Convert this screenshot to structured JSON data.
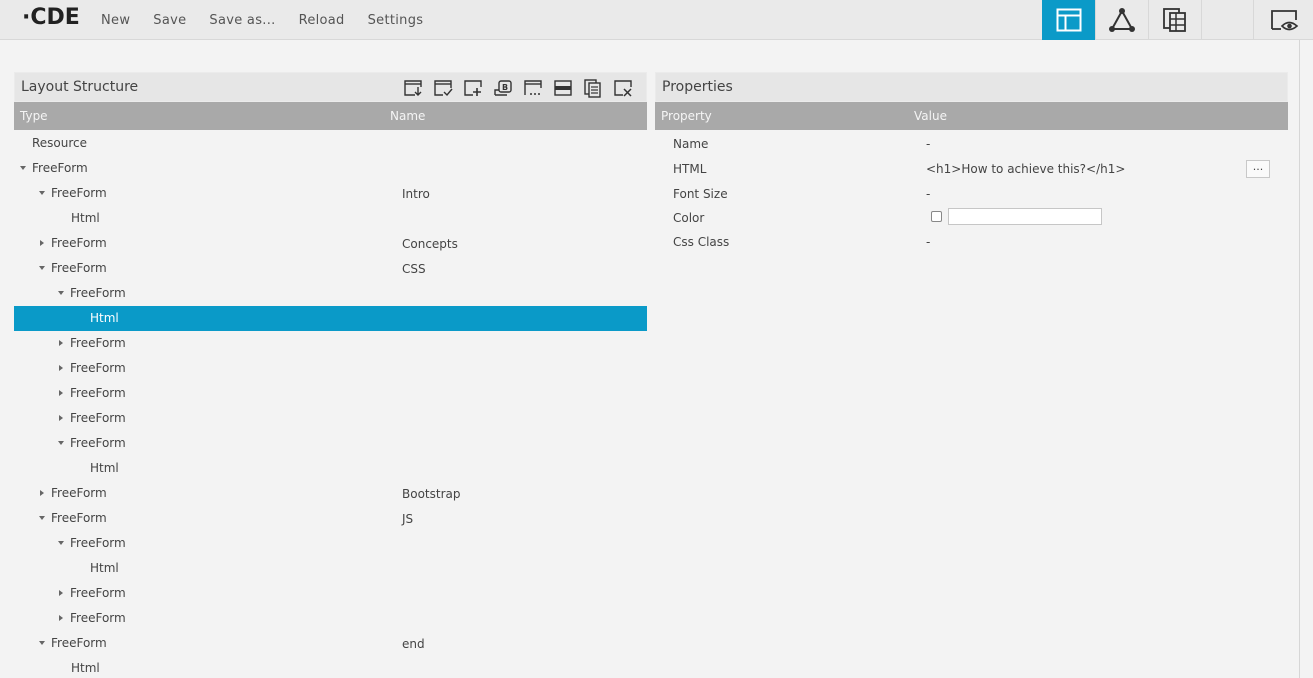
{
  "app": {
    "logo": "CDE",
    "logo_prefix": "·"
  },
  "menu": {
    "new": "New",
    "save": "Save",
    "save_as": "Save as...",
    "reload": "Reload",
    "settings": "Settings"
  },
  "view_buttons": [
    {
      "icon": "layout-icon",
      "active": true
    },
    {
      "icon": "components-icon",
      "active": false
    },
    {
      "icon": "datasources-icon",
      "active": false
    },
    {
      "icon": "preview-icon",
      "active": false
    }
  ],
  "layout": {
    "title": "Layout Structure",
    "col_type": "Type",
    "col_name": "Name",
    "toolbar": [
      "save-template-icon",
      "apply-template-icon",
      "add-row-icon",
      "add-bootstrap-panel-icon",
      "add-freeform-icon",
      "add-html-icon",
      "duplicate-icon",
      "delete-icon"
    ],
    "rows": [
      {
        "type": "Resource",
        "name": "",
        "depth": 0,
        "toggle": "none"
      },
      {
        "type": "FreeForm",
        "name": "",
        "depth": 0,
        "toggle": "down"
      },
      {
        "type": "FreeForm",
        "name": "Intro",
        "depth": 1,
        "toggle": "down"
      },
      {
        "type": "Html",
        "name": "",
        "depth": 2,
        "toggle": "none"
      },
      {
        "type": "FreeForm",
        "name": "Concepts",
        "depth": 1,
        "toggle": "right"
      },
      {
        "type": "FreeForm",
        "name": "CSS",
        "depth": 1,
        "toggle": "down"
      },
      {
        "type": "FreeForm",
        "name": "",
        "depth": 2,
        "toggle": "down"
      },
      {
        "type": "Html",
        "name": "",
        "depth": 3,
        "toggle": "none",
        "selected": true
      },
      {
        "type": "FreeForm",
        "name": "",
        "depth": 2,
        "toggle": "right"
      },
      {
        "type": "FreeForm",
        "name": "",
        "depth": 2,
        "toggle": "right"
      },
      {
        "type": "FreeForm",
        "name": "",
        "depth": 2,
        "toggle": "right"
      },
      {
        "type": "FreeForm",
        "name": "",
        "depth": 2,
        "toggle": "right"
      },
      {
        "type": "FreeForm",
        "name": "",
        "depth": 2,
        "toggle": "down"
      },
      {
        "type": "Html",
        "name": "",
        "depth": 3,
        "toggle": "none"
      },
      {
        "type": "FreeForm",
        "name": "Bootstrap",
        "depth": 1,
        "toggle": "right"
      },
      {
        "type": "FreeForm",
        "name": "JS",
        "depth": 1,
        "toggle": "down"
      },
      {
        "type": "FreeForm",
        "name": "",
        "depth": 2,
        "toggle": "down"
      },
      {
        "type": "Html",
        "name": "",
        "depth": 3,
        "toggle": "none"
      },
      {
        "type": "FreeForm",
        "name": "",
        "depth": 2,
        "toggle": "right"
      },
      {
        "type": "FreeForm",
        "name": "",
        "depth": 2,
        "toggle": "right"
      },
      {
        "type": "FreeForm",
        "name": "end",
        "depth": 1,
        "toggle": "down"
      },
      {
        "type": "Html",
        "name": "",
        "depth": 2,
        "toggle": "none"
      }
    ]
  },
  "properties": {
    "title": "Properties",
    "col_property": "Property",
    "col_value": "Value",
    "name": {
      "label": "Name",
      "value": "-"
    },
    "html": {
      "label": "HTML",
      "value": "<h1>How to achieve this?</h1>",
      "button": "..."
    },
    "font_size": {
      "label": "Font Size",
      "value": "-"
    },
    "color": {
      "label": "Color",
      "value": ""
    },
    "css_class": {
      "label": "Css Class",
      "value": "-"
    }
  },
  "colors": {
    "accent": "#0a9ac8",
    "header": "#a9a9a9",
    "background": "#f3f3f3"
  }
}
